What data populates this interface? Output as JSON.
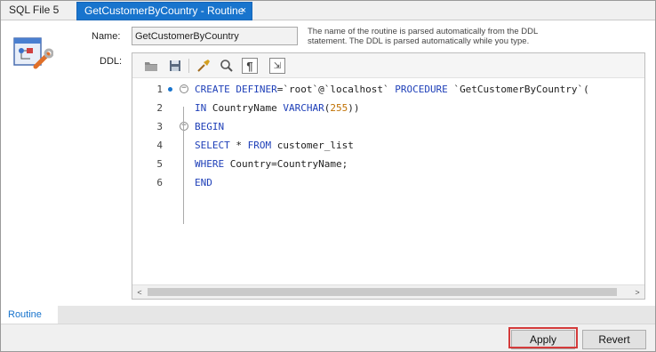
{
  "tabs": [
    {
      "label": "SQL File 5",
      "active": false
    },
    {
      "label": "GetCustomerByCountry - Routine",
      "active": true,
      "close": "×"
    }
  ],
  "form": {
    "name_label": "Name:",
    "name_value": "GetCustomerByCountry",
    "hint": "The name of the routine is parsed automatically from the DDL statement. The DDL is parsed automatically while you type.",
    "ddl_label": "DDL:"
  },
  "toolbar_icons": [
    "open-folder-icon",
    "save-icon",
    "beautify-icon",
    "find-icon",
    "invisible-chars-icon",
    "word-wrap-icon"
  ],
  "code": {
    "lines": [
      {
        "n": "1",
        "breakpoint": true,
        "fold": "−",
        "parts": [
          [
            "kw",
            "CREATE DEFINER"
          ],
          [
            "plain",
            "=`"
          ],
          [
            "str",
            "root"
          ],
          [
            "plain",
            "`@`"
          ],
          [
            "str",
            "localhost"
          ],
          [
            "plain",
            "` "
          ],
          [
            "kw",
            "PROCEDURE"
          ],
          [
            "plain",
            " `"
          ],
          [
            "str",
            "GetCustomerByCountry"
          ],
          [
            "plain",
            "`("
          ]
        ]
      },
      {
        "n": "2",
        "parts": [
          [
            "kw",
            "IN"
          ],
          [
            "plain",
            " CountryName "
          ],
          [
            "kw",
            "VARCHAR"
          ],
          [
            "plain",
            "("
          ],
          [
            "num",
            "255"
          ],
          [
            "plain",
            "))"
          ]
        ]
      },
      {
        "n": "3",
        "fold": "−",
        "parts": [
          [
            "kw",
            "BEGIN"
          ]
        ]
      },
      {
        "n": "4",
        "parts": [
          [
            "kw",
            "SELECT"
          ],
          [
            "plain",
            " * "
          ],
          [
            "kw",
            "FROM"
          ],
          [
            "plain",
            " customer_list"
          ]
        ]
      },
      {
        "n": "5",
        "parts": [
          [
            "kw",
            "WHERE"
          ],
          [
            "plain",
            " Country=CountryName;"
          ]
        ]
      },
      {
        "n": "6",
        "parts": [
          [
            "kw",
            "END"
          ]
        ]
      }
    ]
  },
  "scrollbar": {
    "left_arrow": "<",
    "right_arrow": ">"
  },
  "bottom_tab": "Routine",
  "buttons": {
    "apply": "Apply",
    "revert": "Revert"
  },
  "colors": {
    "accent": "#1874cd",
    "keyword": "#1e3fb8",
    "number": "#c07000",
    "highlight": "#d43b3b"
  }
}
